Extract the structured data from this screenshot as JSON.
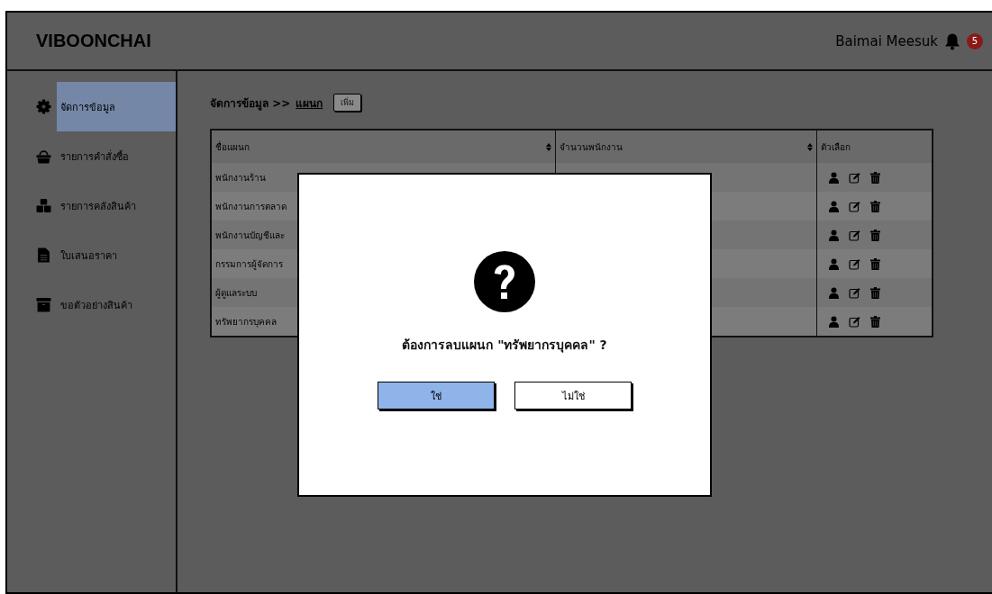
{
  "header": {
    "logo": "VIBOONCHAI",
    "user_name": "Baimai Meesuk",
    "notification_count": "5"
  },
  "sidebar": {
    "items": [
      {
        "label": "จัดการข้อมูล",
        "selected": true
      },
      {
        "label": "รายการคำสั่งซื้อ",
        "selected": false
      },
      {
        "label": "รายการคลังสินค้า",
        "selected": false
      },
      {
        "label": "ใบเสนอราคา",
        "selected": false
      },
      {
        "label": "ขอตัวอย่างสินค้า",
        "selected": false
      }
    ]
  },
  "breadcrumb": {
    "parent": "จัดการข้อมูล >>",
    "current": "แผนก",
    "add_button": "เพิ่ม"
  },
  "table": {
    "columns": [
      {
        "label": "ชื่อแผนก",
        "sortable": true
      },
      {
        "label": "จำนวนพนักงาน",
        "sortable": true
      },
      {
        "label": "ตัวเลือก",
        "sortable": false
      }
    ],
    "rows": [
      {
        "name": "พนักงานร้าน"
      },
      {
        "name": "พนักงานการตลาด"
      },
      {
        "name": "พนักงานบัญชีและ"
      },
      {
        "name": "กรรมการผู้จัดการ"
      },
      {
        "name": "ผู้ดูแลระบบ"
      },
      {
        "name": "ทรัพยากรบุคคล"
      }
    ]
  },
  "dialog": {
    "message": "ต้องการลบแผนก \"ทรัพยากรบุคคล\" ?",
    "buttons": [
      {
        "label": "ใช่",
        "kind": "primary"
      },
      {
        "label": "ไม่ใช่",
        "kind": "secondary"
      }
    ]
  }
}
